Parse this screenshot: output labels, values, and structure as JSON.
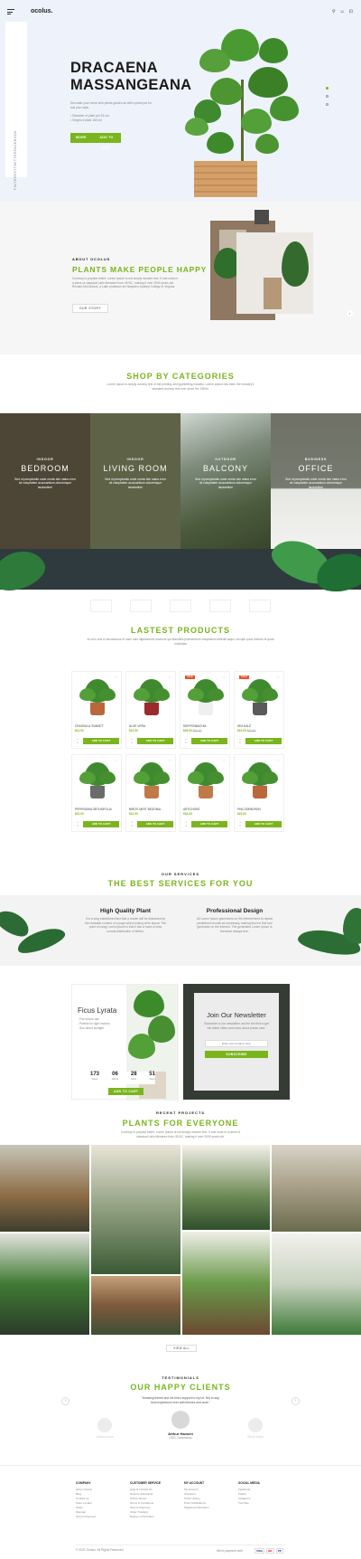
{
  "brand": {
    "logo": "ocolus."
  },
  "hero": {
    "title_line1": "DRACAENA",
    "title_line2": "MASSANGEANA",
    "desc": "Decorate your home with plants garden as with a plant pot for suit your style.",
    "bullets": [
      "Diameter of plant pot 24 cm",
      "Height of plant 160 cm"
    ],
    "btn_more": "MORE",
    "btn_cart": "ADD TO CART",
    "side_links": [
      "FACEBOOK",
      "TWITTER",
      "PINTEREST"
    ]
  },
  "about": {
    "eyebrow": "ABOUT OCOLUS",
    "title": "PLANTS MAKE PEOPLE HAPPY",
    "text": "Contrary to popular belief, Lorem Ipsum is not simply random text. It has roots in a piece of classical Latin literature from 45 BC, making it over 2000 years old. Richard McClintock, a Latin professor at Hampden-Sydney College in Virginia.",
    "button": "OUR STORY"
  },
  "categories": {
    "title": "SHOP BY CATEGORIES",
    "subtitle": "Lorem Ipsum is simply dummy text of the printing and typesetting industry. Lorem Ipsum has been the industry's standard dummy text ever since the 1500s.",
    "items": [
      {
        "eyebrow": "INDOOR",
        "name": "BEDROOM",
        "desc": "Sed ut perspiciatis unde omnis iste natus error sit voluptatem accusantium doloremque laudantium"
      },
      {
        "eyebrow": "INDOOR",
        "name": "LIVING ROOM",
        "desc": "Sed ut perspiciatis unde omnis iste natus error sit voluptatem accusantium doloremque laudantium"
      },
      {
        "eyebrow": "OUTDOOR",
        "name": "BALCONY",
        "desc": "Sed ut perspiciatis unde omnis iste natus error sit voluptatem accusantium doloremque laudantium"
      },
      {
        "eyebrow": "BUSINESS",
        "name": "OFFICE",
        "desc": "Sed ut perspiciatis unde omnis iste natus error sit voluptatem accusantium doloremque laudantium"
      }
    ]
  },
  "products": {
    "title": "LASTEST PRODUCTS",
    "subtitle": "At vero eos et accusamus et iusto odio dignissimos ducimus qui blanditiis praesentium voluptatum deleniti atque corrupti quos dolores et quas molestias",
    "items": [
      {
        "name": "CRASSULA 'SUNSET'",
        "price": "$13.00",
        "old": "",
        "sale": false
      },
      {
        "name": "ALOE VERA",
        "price": "$10.00",
        "old": "",
        "sale": false
      },
      {
        "name": "DIEFFENBACHIA",
        "price": "$26.00",
        "old": "$32.00",
        "sale": true
      },
      {
        "name": "SEA KALE",
        "price": "$19.00",
        "old": "$22.00",
        "sale": true
      },
      {
        "name": "PEPEROMIA OBTUSIFOLIA",
        "price": "$21.00",
        "old": "",
        "sale": false
      },
      {
        "name": "BIRD'S NEST BEGONIA",
        "price": "$12.00",
        "old": "",
        "sale": false
      },
      {
        "name": "ARTICHOKE",
        "price": "$18.00",
        "old": "",
        "sale": false
      },
      {
        "name": "PHILODENDRON",
        "price": "$22.00",
        "old": "",
        "sale": false
      }
    ],
    "add_label": "ADD TO CART"
  },
  "services": {
    "eyebrow": "OUR SERVICES",
    "title": "THE BEST SERVICES FOR YOU",
    "items": [
      {
        "title": "High Quality Plant",
        "text": "It is a long established fact that a reader will be distracted by the readable content of a page when looking at its layout. The point of using Lorem Ipsum is that it has a more-or-less normal distribution of letters."
      },
      {
        "title": "Professional Design",
        "text": "All Lorem Ipsum generators on the Internet tend to repeat predefined chunks as necessary, making this the first true generator on the Internet. The generated Lorem Ipsum is therefore always free."
      }
    ]
  },
  "deal": {
    "title": "Ficus Lyrata",
    "lines": [
      "Fire indoor use",
      "Perfect for light indoors",
      "Sun direct sunlight"
    ],
    "countdown": [
      {
        "num": "173",
        "lbl": "Days"
      },
      {
        "num": "06",
        "lbl": "Hours"
      },
      {
        "num": "28",
        "lbl": "Mins"
      },
      {
        "num": "51",
        "lbl": "Secs"
      }
    ],
    "button": "ADD TO CART"
  },
  "newsletter": {
    "title": "Join Our Newsletter",
    "text": "Subscribe to our newsletter and be the first to get the latest offers and news about plants care.",
    "placeholder": "Enter your email to here",
    "button": "SUBSCRIBE"
  },
  "projects": {
    "eyebrow": "RECENT PROJECTS",
    "title": "PLANTS FOR EVERYONE",
    "subtitle": "Contrary to popular belief, Lorem Ipsum is not simply random text. It has roots in a piece of classical Latin literature from 45 BC, making it over 2000 years old.",
    "view_all": "VIEW ALL"
  },
  "testimonials": {
    "eyebrow": "TESTIMONIALS",
    "title": "OUR HAPPY CLIENTS",
    "quote": "\"Amazing theme and Ive been support to my lot. Not to say, best experience ever with themes and work.\"",
    "name": "Arthur Hansen",
    "role": "CEO, Greenvirus",
    "side_names": [
      "Jessica Anne",
      "Ethan Wells"
    ]
  },
  "footer": {
    "cols": [
      {
        "title": "COMPANY",
        "links": [
          "About Ocolus",
          "Blog",
          "Contact us",
          "Store Locator",
          "FAQs",
          "Sitemap",
          "Secure Payment"
        ]
      },
      {
        "title": "CUSTOMER SERVICE",
        "links": [
          "Help & Contact Us",
          "Returns & Refunds",
          "Online Stores",
          "Terms & Conditions",
          "Secure Payment",
          "Order Tracking",
          "Delivery Information"
        ]
      },
      {
        "title": "MY ACCOUNT",
        "links": [
          "My Account",
          "Checkout",
          "Order History",
          "Price Notifications",
          "Shipping Information"
        ]
      },
      {
        "title": "SOCIAL MEDIA",
        "links": [
          "Facebook",
          "Twitter",
          "Instagram",
          "YouTube"
        ]
      }
    ],
    "copyright": "© 2021 Ocolus. All Rights Reserved.",
    "payments_label": "We're payment with",
    "payments": [
      "VISA",
      "MC",
      "PP"
    ]
  },
  "colors": {
    "accent": "#7ab51d",
    "hero_bg": "#eef2fb"
  },
  "icons": [
    "menu-icon",
    "search-icon",
    "user-icon",
    "cart-icon",
    "heart-icon",
    "chevron-left-icon",
    "chevron-right-icon"
  ]
}
